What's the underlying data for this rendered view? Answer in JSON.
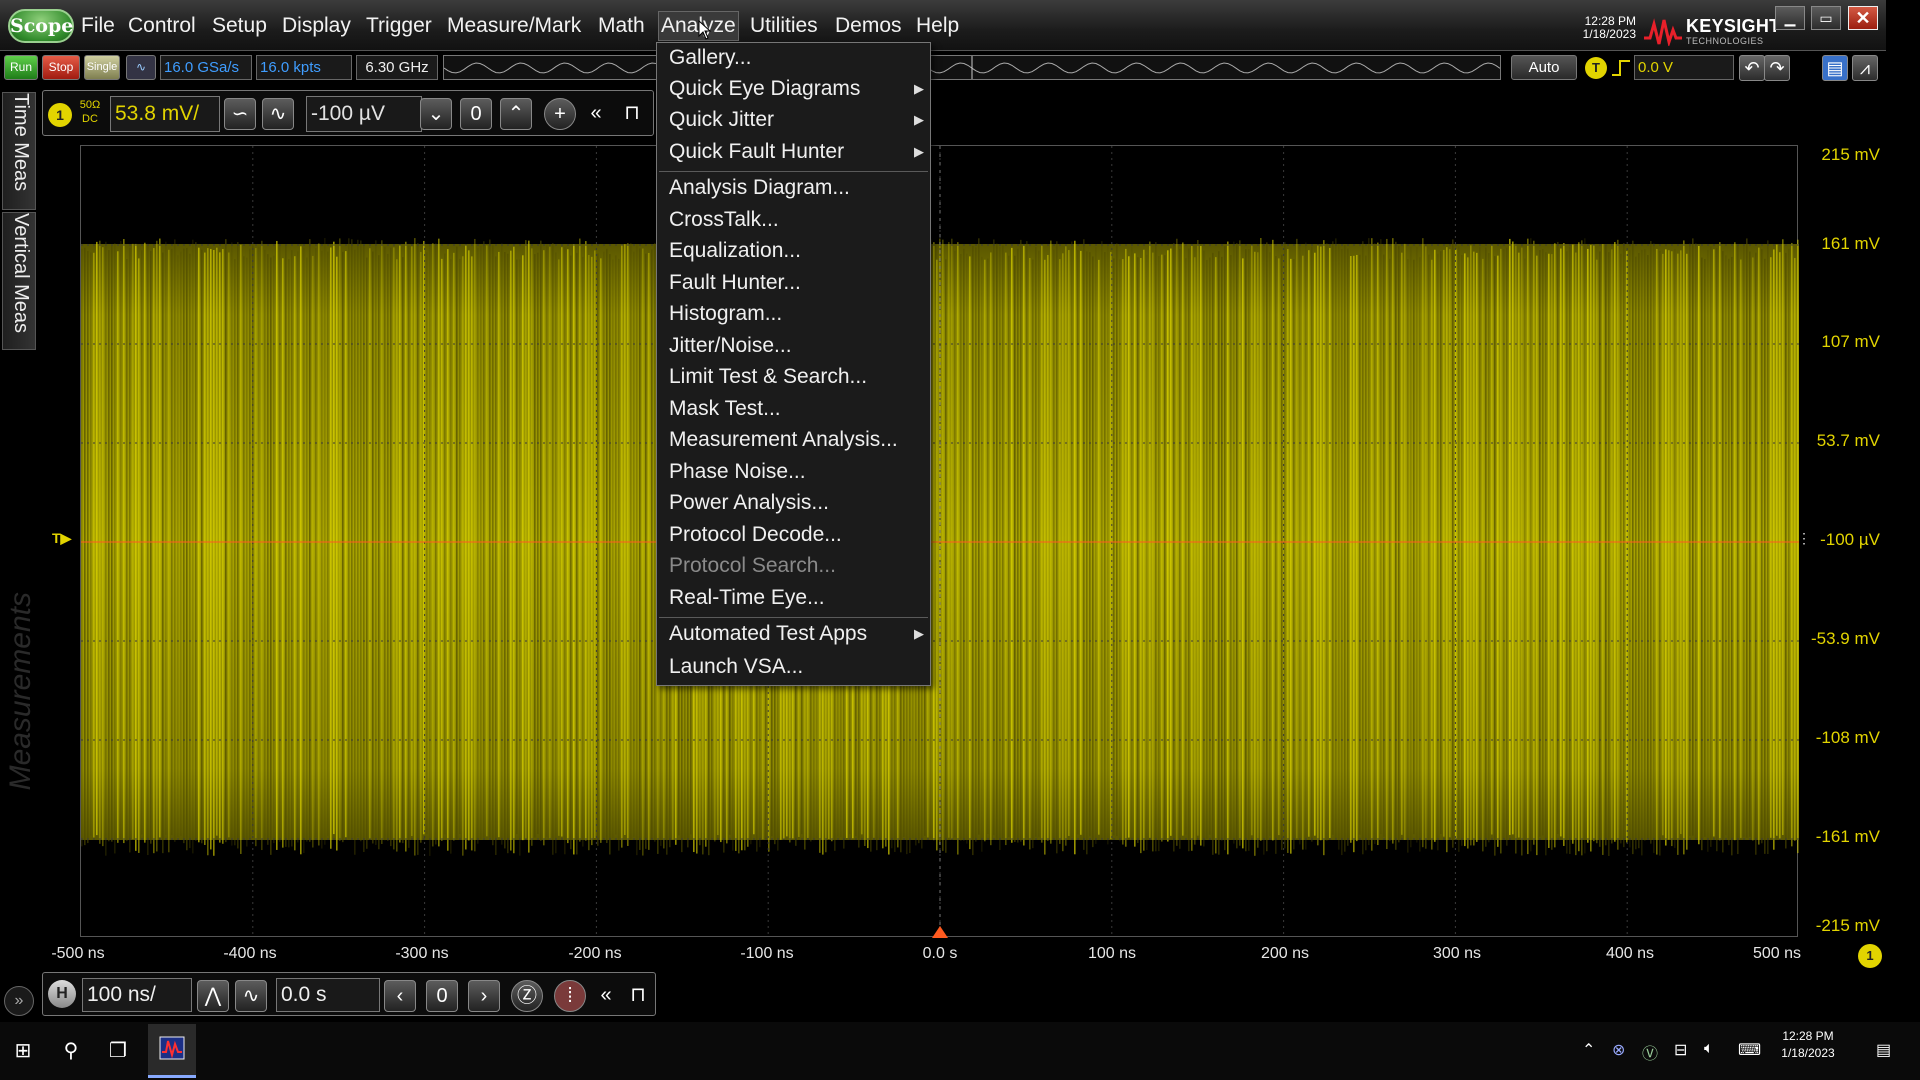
{
  "menubar": {
    "scope_label": "Scope",
    "items": [
      "File",
      "Control",
      "Setup",
      "Display",
      "Trigger",
      "Measure/Mark",
      "Math",
      "Analyze",
      "Utilities",
      "Demos",
      "Help"
    ],
    "time": "12:28 PM",
    "date": "1/18/2023",
    "brand": "KEYSIGHT",
    "brand_sub": "TECHNOLOGIES"
  },
  "toolbar": {
    "run": "Run",
    "stop": "Stop",
    "single": "Single",
    "sample_rate": "16.0 GSa/s",
    "memory_depth": "16.0 kpts",
    "bandwidth": "6.30 GHz",
    "auto": "Auto",
    "trigger_badge": "T",
    "trigger_level": "0.0 V"
  },
  "side_tabs": {
    "time_meas": "Time Meas",
    "vertical_meas": "Vertical Meas",
    "measurements": "Measurements"
  },
  "channel": {
    "number": "1",
    "impedance": "50Ω",
    "coupling": "DC",
    "scale": "53.8 mV/",
    "offset": "-100 µV"
  },
  "y_axis": [
    "215 mV",
    "161 mV",
    "107 mV",
    "53.7 mV",
    "-100 µV",
    "-53.9 mV",
    "-108 mV",
    "-161 mV",
    "-215 mV"
  ],
  "x_axis": [
    "-500 ns",
    "-400 ns",
    "-300 ns",
    "-200 ns",
    "-100 ns",
    "0.0 s",
    "100 ns",
    "200 ns",
    "300 ns",
    "400 ns",
    "500 ns"
  ],
  "horizontal": {
    "badge": "H",
    "scale": "100 ns/",
    "position": "0.0 s",
    "right_badge": "1"
  },
  "taskbar": {
    "time": "12:28 PM",
    "date": "1/18/2023"
  },
  "colors": {
    "channel1": "#e2d400",
    "trigger_line": "#ff5a1f"
  },
  "analyze_menu": {
    "group1": [
      {
        "label": "Gallery...",
        "submenu": false
      },
      {
        "label": "Quick Eye Diagrams",
        "submenu": true
      },
      {
        "label": "Quick Jitter",
        "submenu": true
      },
      {
        "label": "Quick Fault Hunter",
        "submenu": true
      }
    ],
    "group2": [
      {
        "label": "Analysis Diagram...",
        "disabled": false
      },
      {
        "label": "CrossTalk...",
        "disabled": false
      },
      {
        "label": "Equalization...",
        "disabled": false
      },
      {
        "label": "Fault Hunter...",
        "disabled": false
      },
      {
        "label": "Histogram...",
        "disabled": false
      },
      {
        "label": "Jitter/Noise...",
        "disabled": false
      },
      {
        "label": "Limit Test & Search...",
        "disabled": false
      },
      {
        "label": "Mask Test...",
        "disabled": false
      },
      {
        "label": "Measurement Analysis...",
        "disabled": false
      },
      {
        "label": "Phase Noise...",
        "disabled": false
      },
      {
        "label": "Power Analysis...",
        "disabled": false
      },
      {
        "label": "Protocol Decode...",
        "disabled": false
      },
      {
        "label": "Protocol Search...",
        "disabled": true
      },
      {
        "label": "Real-Time Eye...",
        "disabled": false
      }
    ],
    "group3": [
      {
        "label": "Automated Test Apps",
        "submenu": true
      },
      {
        "label": "Launch VSA...",
        "submenu": false
      }
    ]
  }
}
